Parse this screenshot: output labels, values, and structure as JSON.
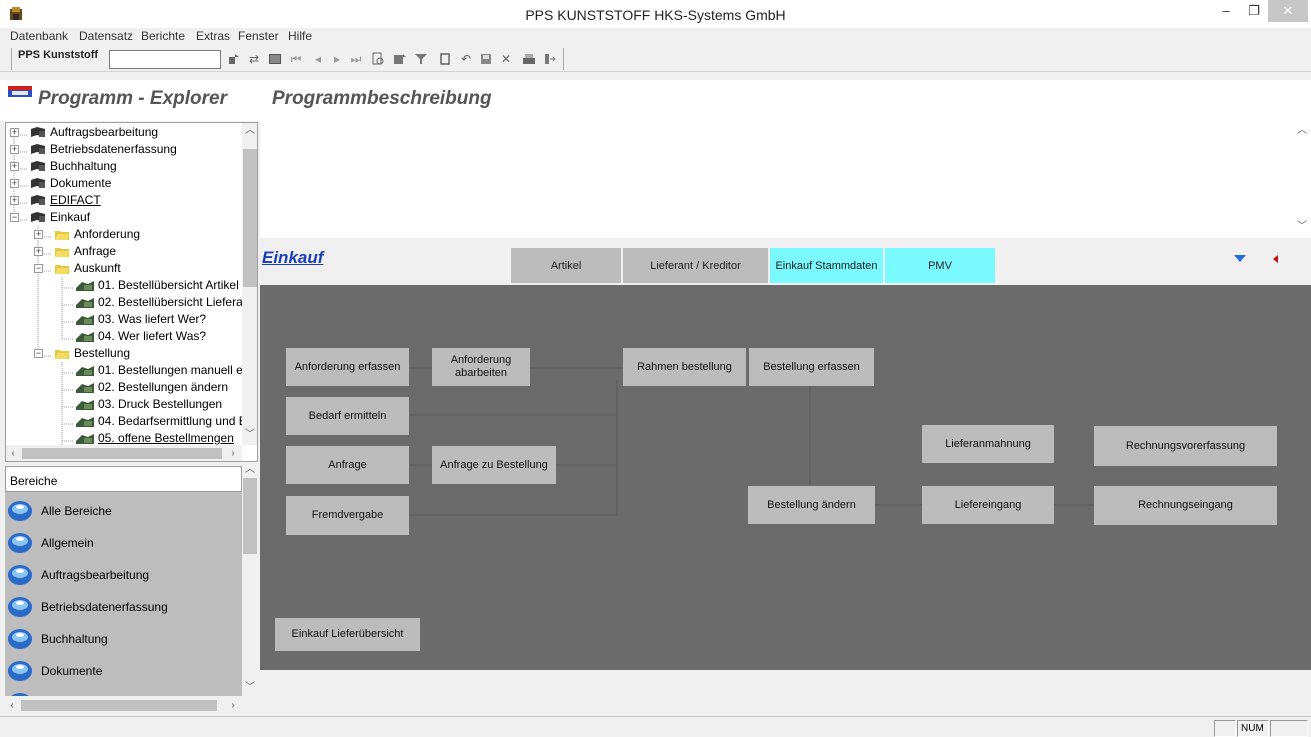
{
  "window": {
    "title": "PPS KUNSTSTOFF HKS-Systems GmbH",
    "minimize_glyph": "–",
    "maximize_glyph": "❐",
    "close_glyph": "✕"
  },
  "menu": {
    "items": [
      "Datenbank",
      "Datensatz",
      "Berichte",
      "Extras",
      "Fenster",
      "Hilfe"
    ]
  },
  "toolbar": {
    "org_label": "PPS Kunststoff",
    "org_value": "",
    "icons": [
      "new-record-icon",
      "refresh-icon",
      "table-icon",
      "first-record-icon",
      "prev-record-icon",
      "next-record-icon",
      "last-record-icon",
      "search-icon",
      "filter-icon",
      "filter-funnel-icon",
      "page-icon",
      "undo-icon",
      "save-icon",
      "delete-icon",
      "print-icon",
      "exit-icon"
    ]
  },
  "explorer": {
    "title": "Programm - Explorer",
    "tree": [
      {
        "label": "Auftragsbearbeitung",
        "type": "book",
        "level": 0,
        "expander": "+"
      },
      {
        "label": "Betriebsdatenerfassung",
        "type": "book",
        "level": 0,
        "expander": "+"
      },
      {
        "label": "Buchhaltung",
        "type": "book",
        "level": 0,
        "expander": "+"
      },
      {
        "label": "Dokumente",
        "type": "book",
        "level": 0,
        "expander": "+"
      },
      {
        "label": "EDIFACT",
        "type": "book",
        "level": 0,
        "expander": "+",
        "underline": true
      },
      {
        "label": "Einkauf",
        "type": "book",
        "level": 0,
        "expander": "−"
      },
      {
        "label": "Anforderung",
        "type": "folder",
        "level": 1,
        "expander": "+"
      },
      {
        "label": "Anfrage",
        "type": "folder",
        "level": 1,
        "expander": "+"
      },
      {
        "label": "Auskunft",
        "type": "folder",
        "level": 1,
        "expander": "−"
      },
      {
        "label": "01. Bestellübersicht Artikel",
        "type": "doc",
        "level": 2
      },
      {
        "label": "02. Bestellübersicht Liefera",
        "type": "doc",
        "level": 2
      },
      {
        "label": "03. Was liefert Wer?",
        "type": "doc",
        "level": 2
      },
      {
        "label": "04. Wer liefert Was?",
        "type": "doc",
        "level": 2
      },
      {
        "label": "Bestellung",
        "type": "folder",
        "level": 1,
        "expander": "−"
      },
      {
        "label": "01. Bestellungen manuell e",
        "type": "doc",
        "level": 2
      },
      {
        "label": "02. Bestellungen ändern",
        "type": "doc",
        "level": 2
      },
      {
        "label": "03. Druck Bestellungen",
        "type": "doc",
        "level": 2
      },
      {
        "label": "04. Bedarfsermittlung und E",
        "type": "doc",
        "level": 2
      },
      {
        "label": "05. offene Bestellmengen",
        "type": "doc",
        "level": 2
      }
    ]
  },
  "bereiche": {
    "title": "Bereiche",
    "items": [
      "Alle Bereiche",
      "Allgemein",
      "Auftragsbearbeitung",
      "Betriebsdatenerfassung",
      "Buchhaltung",
      "Dokumente"
    ]
  },
  "description": {
    "title": "Programmbeschreibung",
    "text": ""
  },
  "einkauf": {
    "title": "Einkauf",
    "tabs": [
      "Artikel",
      "Lieferant / Kreditor",
      "Einkauf Stammdaten",
      "PMV"
    ]
  },
  "diagram": {
    "nodes": {
      "anforderung_erfassen": "Anforderung erfassen",
      "anforderung_abarbeiten": "Anforderung abarbeiten",
      "rahmen_bestellung": "Rahmen bestellung",
      "bestellung_erfassen": "Bestellung erfassen",
      "bedarf_ermitteln": "Bedarf ermitteln",
      "lieferanmahnung": "Lieferanmahnung",
      "rechnungsvorerfassung": "Rechnungsvorerfassung",
      "anfrage": "Anfrage",
      "anfrage_zu_bestellung": "Anfrage zu Bestellung",
      "bestellung_aendern": "Bestellung ändern",
      "liefereingang": "Liefereingang",
      "rechnungseingang": "Rechnungseingang",
      "fremdvergabe": "Fremdvergabe",
      "einkauf_lieferuebersicht": "Einkauf Lieferübersicht"
    },
    "background": "#6b6b6b",
    "node_color": "#bcbcbc"
  },
  "status": {
    "num": "NUM"
  },
  "colors": {
    "link": "#1a3eb8",
    "tab_cyan": "#7af9ff",
    "tab_grey": "#bcbcbc",
    "nav_blue": "#1e6fd8",
    "nav_red": "#c01010"
  }
}
